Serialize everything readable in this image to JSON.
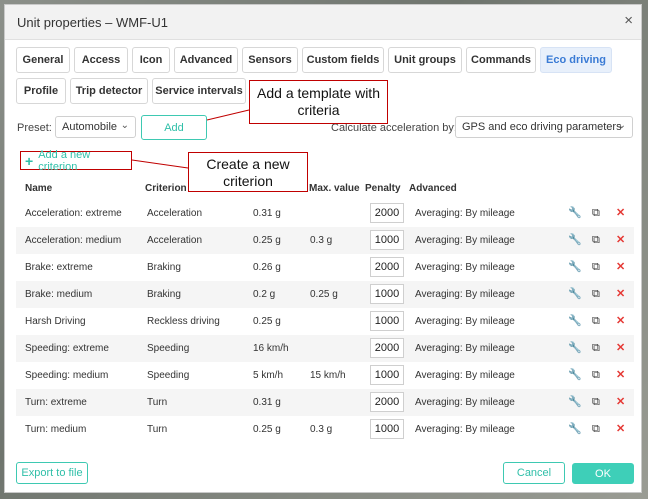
{
  "dialog": {
    "title": "Unit properties – WMF-U1",
    "close_icon": "×"
  },
  "tabs_row1": [
    "General",
    "Access",
    "Icon",
    "Advanced",
    "Sensors",
    "Custom fields",
    "Unit groups",
    "Commands",
    "Eco driving"
  ],
  "tabs_row2": [
    "Profile",
    "Trip detector",
    "Service intervals"
  ],
  "active_tab": "Eco driving",
  "callouts": {
    "template": "Add a template with criteria",
    "criterion": "Create a new criterion"
  },
  "preset": {
    "label": "Preset:",
    "value": "Automobile",
    "add_button": "Add"
  },
  "acceleration": {
    "label": "Calculate acceleration by:",
    "value": "GPS and eco driving parameters"
  },
  "add_criterion": "Add a new criterion",
  "columns": {
    "name": "Name",
    "criterion": "Criterion",
    "max": "Max. value",
    "penalty": "Penalty",
    "advanced": "Advanced"
  },
  "rows": [
    {
      "name": "Acceleration: extreme",
      "criterion": "Acceleration",
      "min": "0.31 g",
      "max": "",
      "penalty": "2000",
      "advanced": "Averaging: By mileage"
    },
    {
      "name": "Acceleration: medium",
      "criterion": "Acceleration",
      "min": "0.25 g",
      "max": "0.3 g",
      "penalty": "1000",
      "advanced": "Averaging: By mileage"
    },
    {
      "name": "Brake: extreme",
      "criterion": "Braking",
      "min": "0.26 g",
      "max": "",
      "penalty": "2000",
      "advanced": "Averaging: By mileage"
    },
    {
      "name": "Brake: medium",
      "criterion": "Braking",
      "min": "0.2 g",
      "max": "0.25 g",
      "penalty": "1000",
      "advanced": "Averaging: By mileage"
    },
    {
      "name": "Harsh Driving",
      "criterion": "Reckless driving",
      "min": "0.25 g",
      "max": "",
      "penalty": "1000",
      "advanced": "Averaging: By mileage"
    },
    {
      "name": "Speeding: extreme",
      "criterion": "Speeding",
      "min": "16 km/h",
      "max": "",
      "penalty": "2000",
      "advanced": "Averaging: By mileage"
    },
    {
      "name": "Speeding: medium",
      "criterion": "Speeding",
      "min": "5 km/h",
      "max": "15 km/h",
      "penalty": "1000",
      "advanced": "Averaging: By mileage"
    },
    {
      "name": "Turn: extreme",
      "criterion": "Turn",
      "min": "0.31 g",
      "max": "",
      "penalty": "2000",
      "advanced": "Averaging: By mileage"
    },
    {
      "name": "Turn: medium",
      "criterion": "Turn",
      "min": "0.25 g",
      "max": "0.3 g",
      "penalty": "1000",
      "advanced": "Averaging: By mileage"
    }
  ],
  "row_icons": {
    "settings": "wrench-icon",
    "copy": "copy-icon",
    "delete": "delete-icon"
  },
  "footer": {
    "export": "Export to file",
    "cancel": "Cancel",
    "ok": "OK"
  },
  "colors": {
    "accent": "#3ecfb8",
    "active_tab_text": "#3a7bd5",
    "callout_border": "#c00000",
    "delete": "#e53935"
  }
}
